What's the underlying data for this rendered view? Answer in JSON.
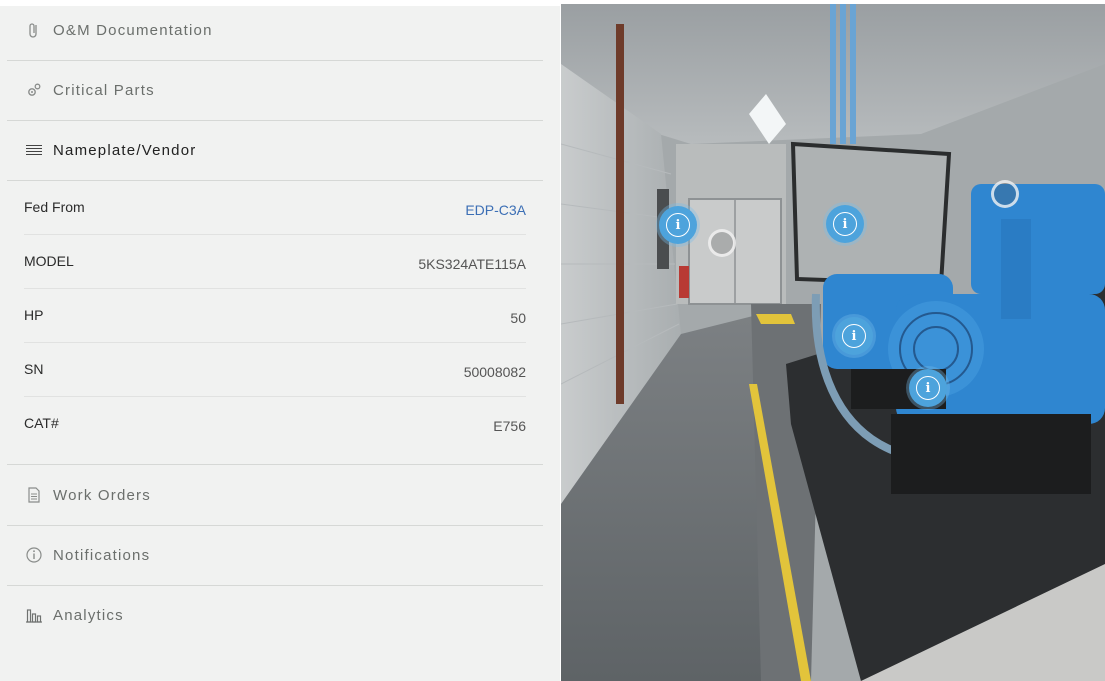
{
  "sidebar": {
    "sections_top": [
      {
        "label": "O&M Documentation",
        "icon": "paperclip-icon"
      },
      {
        "label": "Critical Parts",
        "icon": "gears-icon"
      },
      {
        "label": "Nameplate/Vendor",
        "icon": "list-lines-icon"
      }
    ],
    "details": [
      {
        "key": "Fed From",
        "value": "EDP-C3A",
        "is_link": true
      },
      {
        "key": "MODEL",
        "value": "5KS324ATE115A"
      },
      {
        "key": "HP",
        "value": "50"
      },
      {
        "key": "SN",
        "value": "50008082"
      },
      {
        "key": "CAT#",
        "value": "E756"
      }
    ],
    "sections_bottom": [
      {
        "label": "Work Orders",
        "icon": "document-icon"
      },
      {
        "label": "Notifications",
        "icon": "info-circle-icon"
      },
      {
        "label": "Analytics",
        "icon": "bar-chart-icon"
      }
    ]
  },
  "viewer": {
    "hotspot_glyph": "i",
    "colors": {
      "hotspot": "#4da3dc",
      "link": "#3c6fb5",
      "motor": "#2f86d0"
    }
  }
}
